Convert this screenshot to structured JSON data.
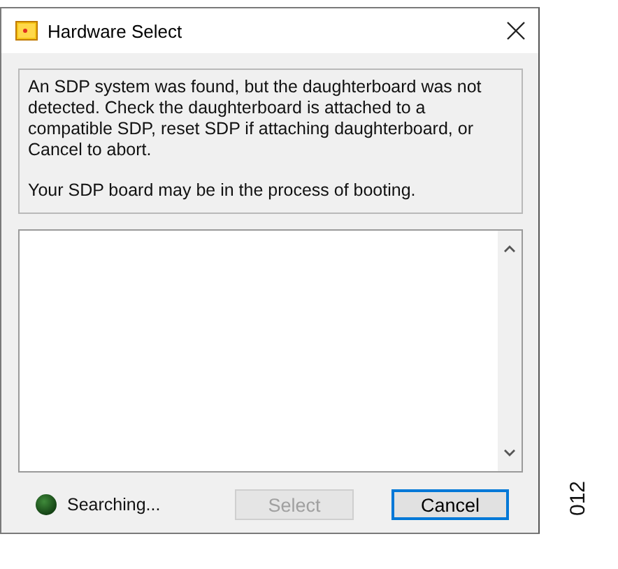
{
  "window": {
    "title": "Hardware Select"
  },
  "message": [
    "An SDP system was found, but the daughterboard was not detected. Check the daughterboard is attached to a compatible SDP, reset SDP if attaching daughterboard, or Cancel to abort.",
    "Your SDP board may be in the process of booting."
  ],
  "status": {
    "text": "Searching..."
  },
  "buttons": [
    {
      "label": "Select",
      "disabled": true,
      "focused": false
    },
    {
      "label": "Cancel",
      "disabled": false,
      "focused": true
    }
  ],
  "figure_number": "012"
}
